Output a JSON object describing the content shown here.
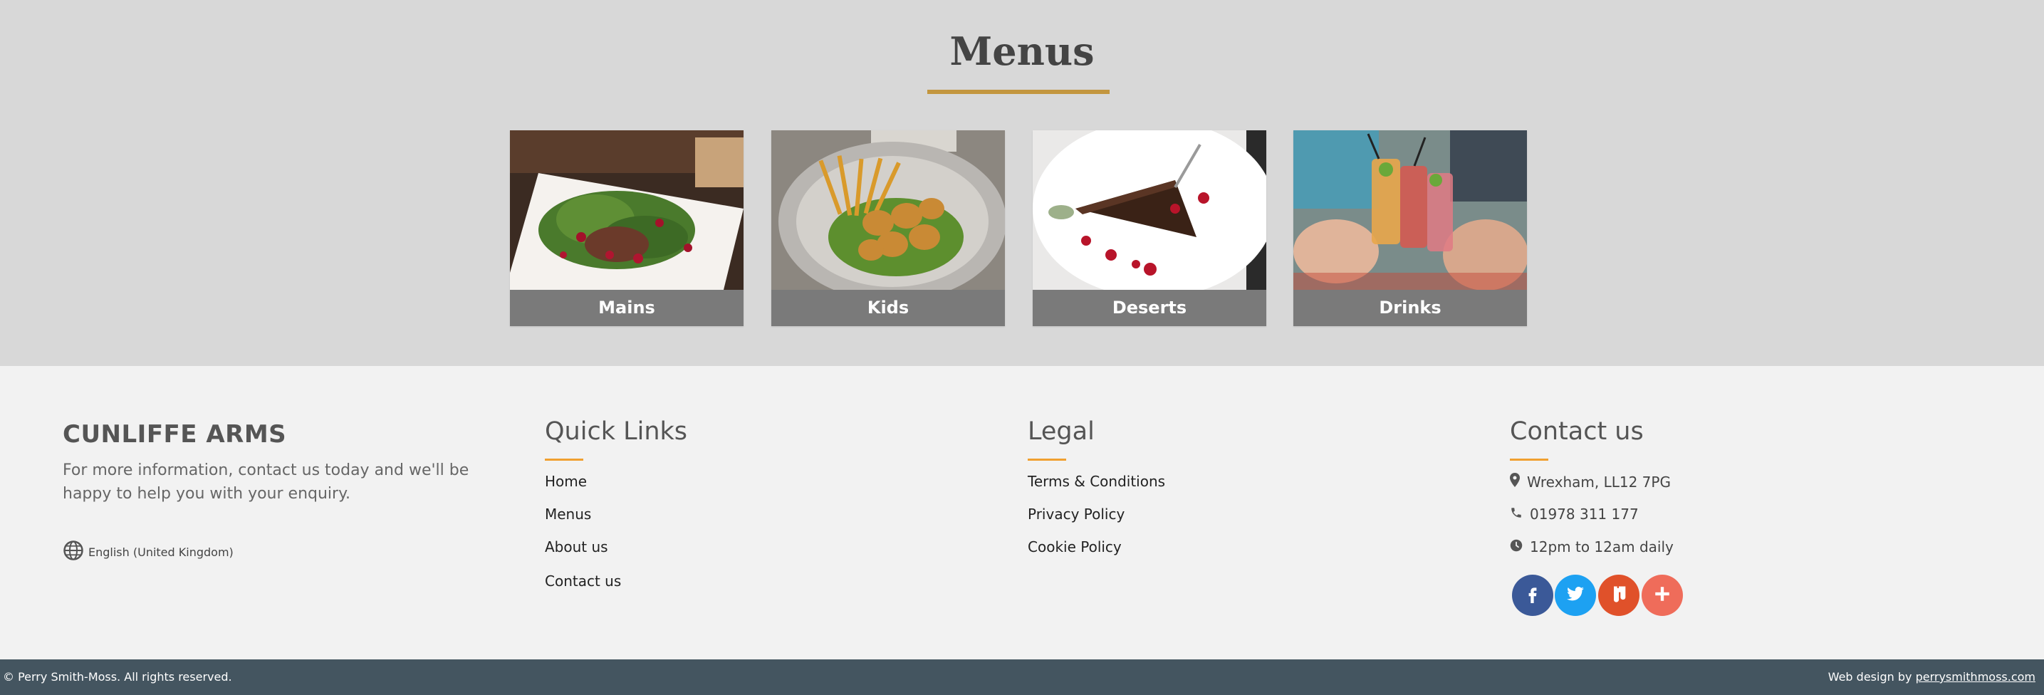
{
  "menus": {
    "title": "Menus",
    "cards": [
      {
        "label": "Mains"
      },
      {
        "label": "Kids"
      },
      {
        "label": "Deserts"
      },
      {
        "label": "Drinks"
      }
    ]
  },
  "footer": {
    "brand": "CUNLIFFE ARMS",
    "description": "For more information, contact us today and we'll be happy to help you with your enquiry.",
    "language": "English (United Kingdom)",
    "quick_links": {
      "title": "Quick Links",
      "items": [
        "Home",
        "Menus",
        "About us",
        "Contact us"
      ]
    },
    "legal": {
      "title": "Legal",
      "items": [
        "Terms & Conditions",
        "Privacy Policy",
        "Cookie Policy"
      ]
    },
    "contact": {
      "title": "Contact us",
      "address": "Wrexham, LL12 7PG",
      "phone": "01978 311 177",
      "hours": "12pm to 12am daily"
    },
    "social": [
      {
        "icon": "facebook-icon",
        "color": "#3b5998"
      },
      {
        "icon": "twitter-icon",
        "color": "#1da1f2"
      },
      {
        "icon": "mix-icon",
        "color": "#e0512a"
      },
      {
        "icon": "plus-icon",
        "color": "#ef6c5a"
      }
    ]
  },
  "bottom_bar": {
    "copyright": "© Perry Smith-Moss. All rights reserved.",
    "credit_prefix": "Web design by",
    "credit_link": "perrysmithmoss.com"
  },
  "colors": {
    "accent": "#c3963f",
    "footer_accent": "#f0a030",
    "bottom_bar": "#445560"
  }
}
